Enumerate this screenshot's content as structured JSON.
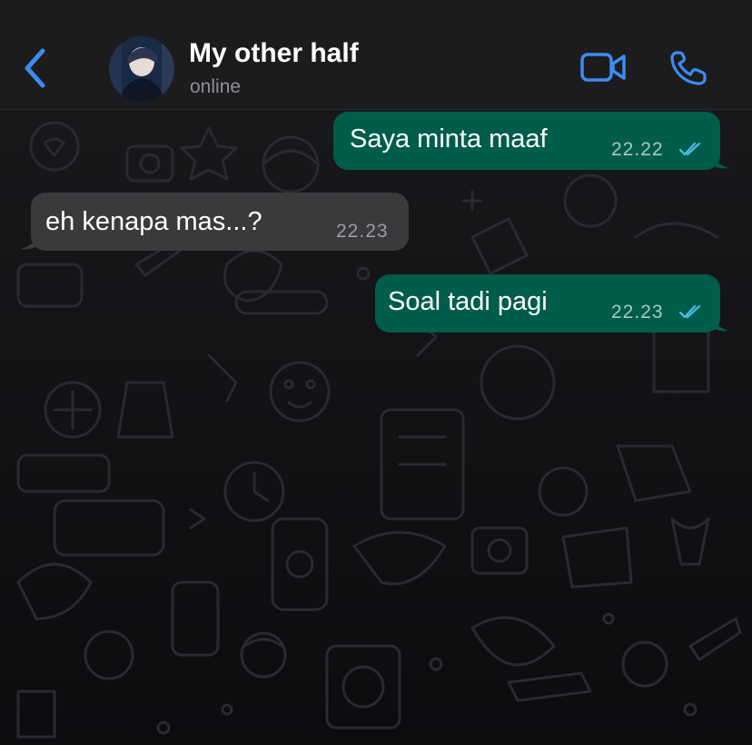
{
  "header": {
    "contact_name": "My other half",
    "status": "online",
    "icons": [
      "chevron-left-icon",
      "avatar",
      "video-call-icon",
      "phone-call-icon"
    ]
  },
  "messages": [
    {
      "direction": "outgoing",
      "text": "Saya minta maaf",
      "time": "22.22",
      "read": true
    },
    {
      "direction": "incoming",
      "text": "eh kenapa mas...?",
      "time": "22.23"
    },
    {
      "direction": "outgoing",
      "text": "Soal tadi pagi",
      "time": "22.23",
      "read": true
    }
  ],
  "colors": {
    "accent": "#3d8cf0",
    "outgoing_bubble": "#005c4b",
    "incoming_bubble": "#3a3a3c",
    "read_ticks": "#53bdeb"
  }
}
